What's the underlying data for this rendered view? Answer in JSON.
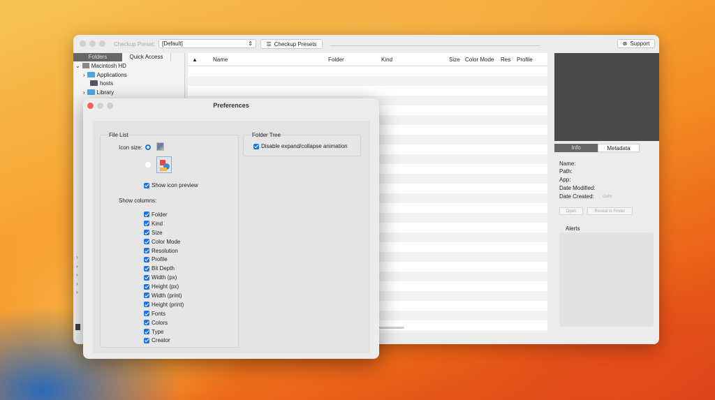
{
  "main_window": {
    "toolbar": {
      "preset_label": "Checkup Preset:",
      "preset_value": "[Default]",
      "presets_button": "Checkup Presets",
      "support_button": "Support"
    },
    "sidebar": {
      "tabs": [
        "Folders",
        "Quick Access"
      ],
      "tree": [
        {
          "label": "Macintosh HD",
          "expanded": true
        },
        {
          "label": "Applications"
        },
        {
          "label": "hosts"
        },
        {
          "label": "Library"
        }
      ]
    },
    "file_list": {
      "columns": [
        "Name",
        "Folder",
        "Kind",
        "Size",
        "Color Mode",
        "Res",
        "Profile"
      ]
    },
    "right_panel": {
      "tabs": [
        "Info",
        "Metadata"
      ],
      "info": {
        "name": "Name:",
        "path": "Path:",
        "app": "App:",
        "date_modified": "Date Modified:",
        "date_created": "Date Created:",
        "date_placeholder": "date"
      },
      "open_button": "Open",
      "reveal_button": "Reveal in Finder",
      "alerts_label": "Alerts"
    }
  },
  "preferences": {
    "title": "Preferences",
    "file_list": {
      "legend": "File List",
      "icon_size_label": "Icon size:",
      "icon_size_selected": "small",
      "show_icon_preview": "Show icon preview",
      "show_columns_label": "Show columns:",
      "columns": [
        "Folder",
        "Kind",
        "Size",
        "Color Mode",
        "Resolution",
        "Profile",
        "Bit Depth",
        "Width (px)",
        "Height (px)",
        "Width (print)",
        "Height (print)",
        "Fonts",
        "Colors",
        "Type",
        "Creator"
      ]
    },
    "folder_tree": {
      "legend": "Folder Tree",
      "disable_animation": "Disable expand/collapse animation"
    }
  }
}
